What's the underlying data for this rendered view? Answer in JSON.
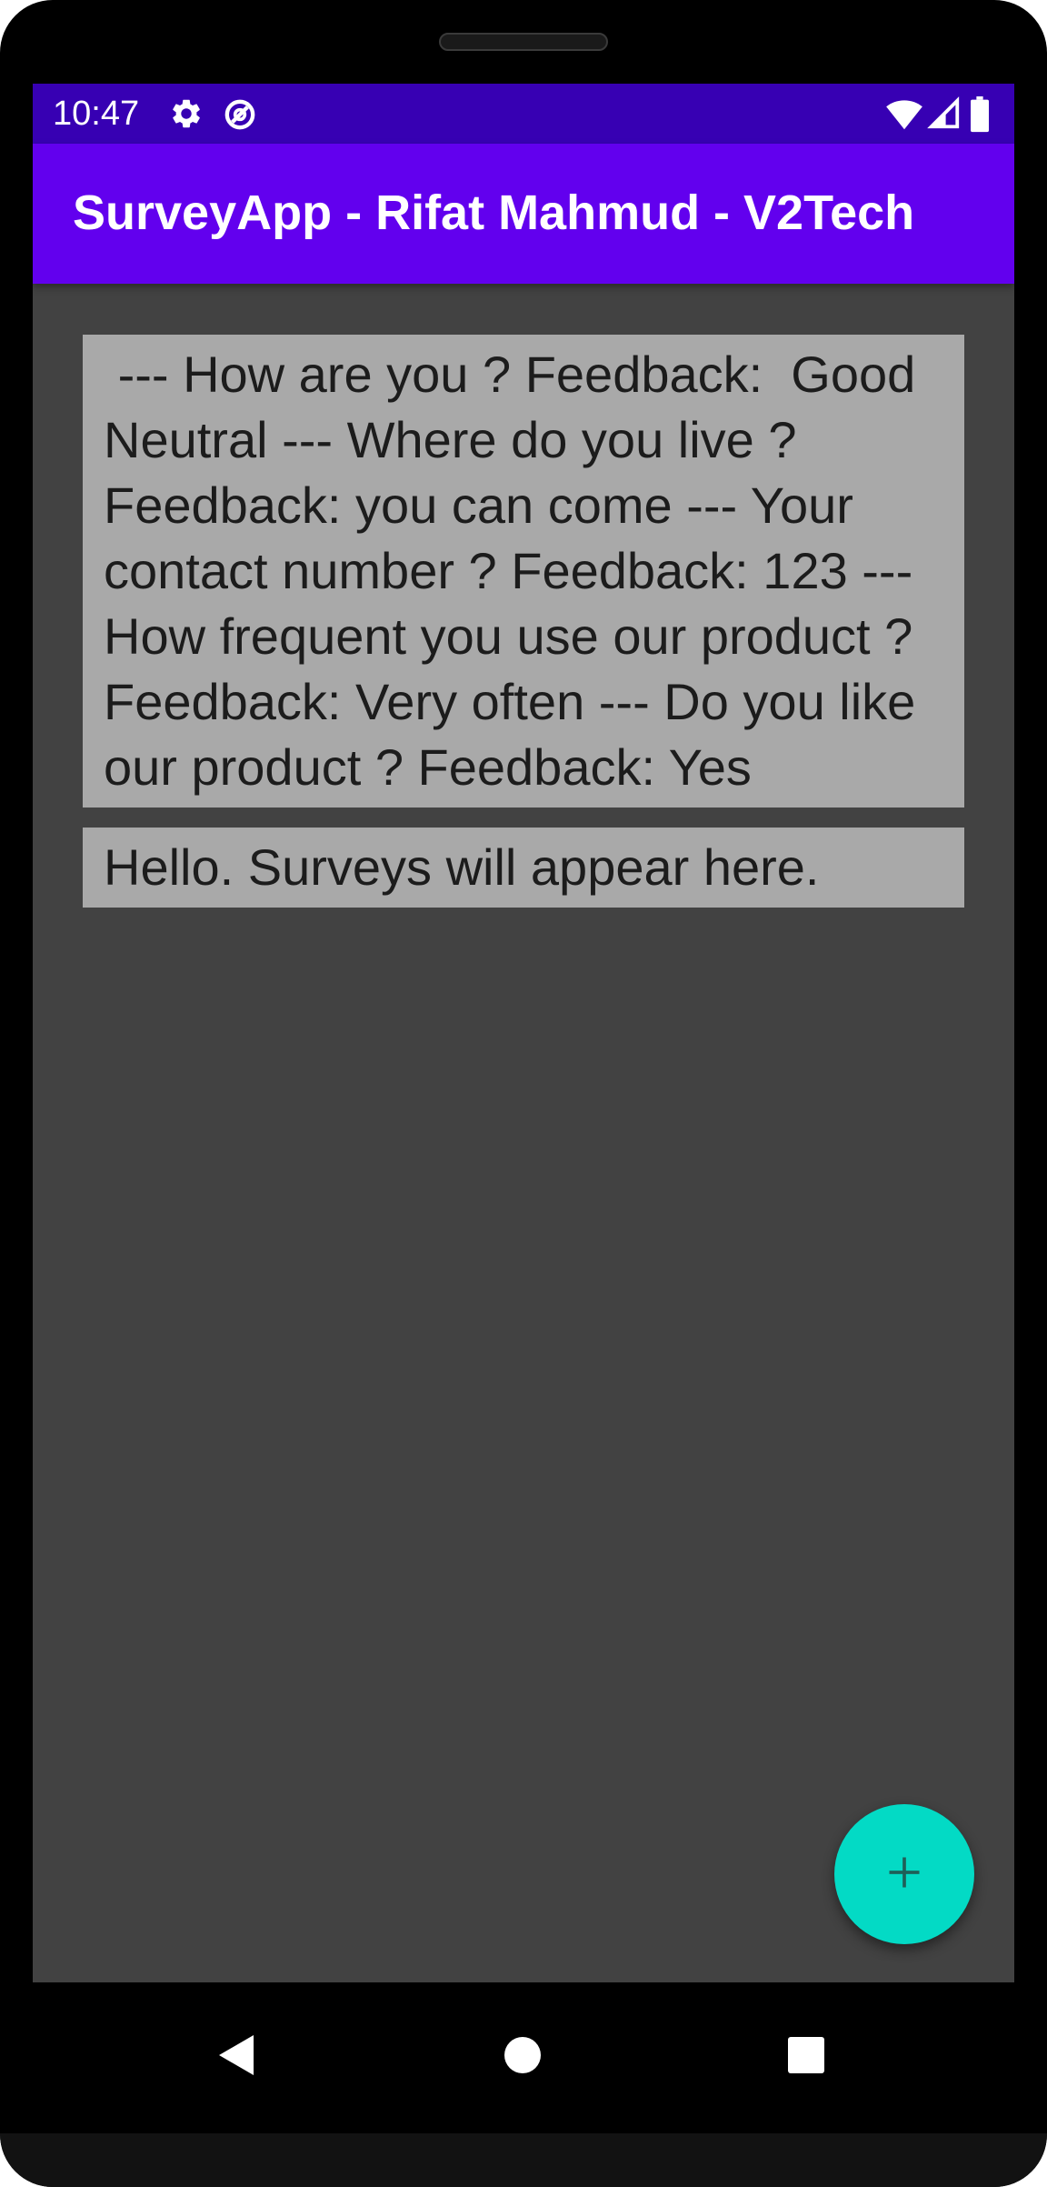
{
  "status_bar": {
    "time": "10:47",
    "icons_left": [
      "gear-icon",
      "data-saver-icon"
    ],
    "icons_right": [
      "wifi-icon",
      "cell-signal-icon",
      "battery-icon"
    ],
    "background_color": "#3700b3"
  },
  "app_bar": {
    "title": "SurveyApp - Rifat Mahmud - V2Tech",
    "background_color": "#6200ee"
  },
  "surveys": [
    {
      "text": " --- How are you ? Feedback:  Good Neutral --- Where do you live ? Feedback: you can come --- Your contact number ? Feedback: 123 --- How frequent you use our product ? Feedback: Very often --- Do you like our product ? Feedback: Yes"
    },
    {
      "text": "Hello. Surveys will appear here."
    }
  ],
  "fab": {
    "icon": "plus-icon",
    "color": "#03dac5"
  },
  "nav_bar": {
    "buttons": [
      "back-icon",
      "home-icon",
      "recents-icon"
    ]
  },
  "colors": {
    "screen_background": "#424242",
    "list_item_background": "#a9a9a9",
    "list_item_text": "#1c1c1c"
  }
}
